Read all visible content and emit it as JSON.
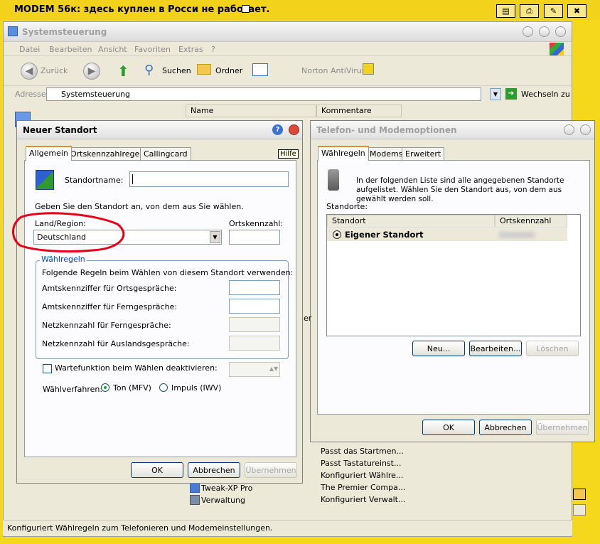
{
  "forum": {
    "title": "MODEM 56к: здесь куплен в Росси не работает.",
    "buttons": [
      "note-icon",
      "print-icon",
      "edit-icon",
      "delete-icon"
    ]
  },
  "explorer": {
    "title": "Systemsteuerung",
    "menu": [
      "Datei",
      "Bearbeiten",
      "Ansicht",
      "Favoriten",
      "Extras",
      "?"
    ],
    "toolbar": {
      "back": "Zurück",
      "search": "Suchen",
      "folders": "Ordner",
      "norton": "Norton AntiVirus"
    },
    "address": {
      "label": "Adresse",
      "value": "Systemsteuerung",
      "go": "Wechseln zu"
    },
    "columns": [
      "Name",
      "Kommentare"
    ],
    "items": [
      {
        "name": "Tweak-XP Pro",
        "comment": "The Premier Compa..."
      },
      {
        "name": "Verwaltung",
        "comment": "Konfiguriert Verwalt..."
      }
    ],
    "comments_above": [
      "Passt das Startmen...",
      "Passt Tastatureinst...",
      "Konfiguriert Wählre..."
    ],
    "status": "Konfiguriert Wählregeln zum Telefonieren und Modemeinstellungen."
  },
  "neuer_standort": {
    "title": "Neuer Standort",
    "tabs": [
      "Allgemein",
      "Ortskennzahlregeln",
      "Callingcard"
    ],
    "tooltip": "Hilfe",
    "standortname_label": "Standortname:",
    "standortname_value": "",
    "instruction": "Geben Sie den Standort an, von dem aus Sie wählen.",
    "land_label": "Land/Region:",
    "land_value": "Deutschland",
    "ortskennzahl_label": "Ortskennzahl:",
    "group_label": "Wählregeln",
    "group_desc": "Folgende Regeln beim Wählen von diesem Standort verwenden:",
    "fields": [
      "Amtskennziffer für Ortsgespräche:",
      "Amtskennziffer für Ferngespräche:",
      "Netzkennzahl für Ferngespräche:",
      "Netzkennzahl für Auslandsgespräche:"
    ],
    "wartefunktion": "Wartefunktion beim Wählen deaktivieren:",
    "waehlverfahren_label": "Wählverfahren:",
    "ton": "Ton (MFV)",
    "impuls": "Impuls (IWV)",
    "ok": "OK",
    "abbrechen": "Abbrechen",
    "uebernehmen": "Übernehmen"
  },
  "telefon": {
    "title": "Telefon- und Modemoptionen",
    "tabs": [
      "Wählregeln",
      "Modems",
      "Erweitert"
    ],
    "info": "In der folgenden Liste sind alle angegebenen Standorte aufgelistet. Wählen Sie den Standort aus, von dem aus gewählt werden soll.",
    "standorte_label": "Standorte:",
    "columns": [
      "Standort",
      "Ortskennzahl"
    ],
    "rows": [
      {
        "name": "Eigener Standort",
        "code": ""
      }
    ],
    "neu": "Neu...",
    "bearbeiten": "Bearbeiten...",
    "loeschen": "Löschen",
    "ok": "OK",
    "abbrechen": "Abbrechen",
    "uebernehmen": "Übernehmen"
  },
  "colors": {
    "forum_bg": "#f5d81b",
    "annotation": "#e8001a",
    "xp_face": "#ece9d8",
    "tab_highlight": "#e68b2c"
  }
}
